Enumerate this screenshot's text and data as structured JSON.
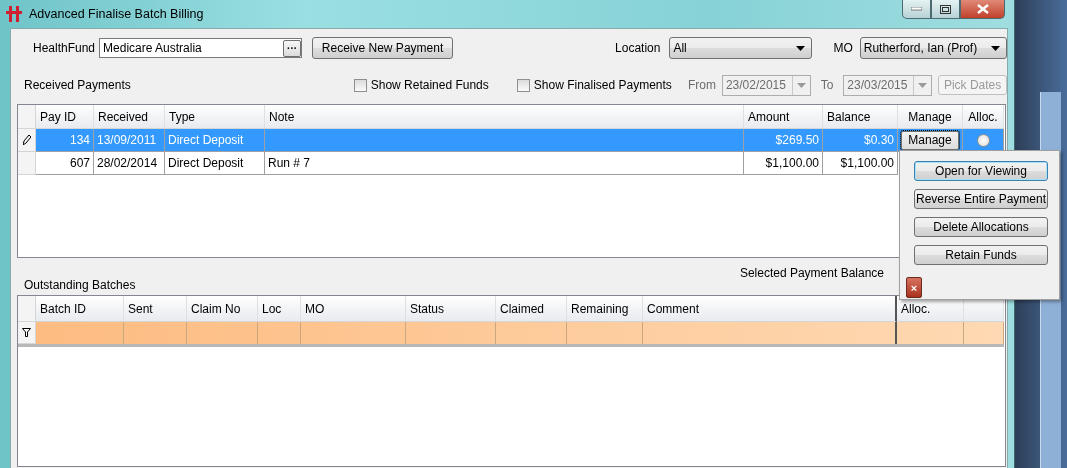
{
  "window": {
    "title": "Advanced Finalise Batch Billing"
  },
  "filters": {
    "health_fund": {
      "label": "HealthFund",
      "value": "Medicare Australia",
      "browse": "···"
    },
    "receive_button": "Receive New Payment",
    "location": {
      "label": "Location",
      "value": "All"
    },
    "mo": {
      "label": "MO",
      "value": "Rutherford, Ian (Prof)"
    }
  },
  "received_payments": {
    "title": "Received Payments",
    "options": [
      {
        "label": "Show Retained Funds",
        "checked": false
      },
      {
        "label": "Show Finalised Payments",
        "checked": false
      }
    ],
    "from": {
      "label": "From",
      "value": "23/02/2015",
      "disabled": true
    },
    "to": {
      "label": "To",
      "value": "23/03/2015",
      "disabled": true
    },
    "pick_dates": {
      "label": "Pick Dates",
      "disabled": true
    },
    "columns": [
      "Pay ID",
      "Received",
      "Type",
      "Note",
      "Amount",
      "Balance",
      "Manage",
      "Alloc."
    ],
    "rows": [
      {
        "selected": true,
        "editing": true,
        "pay_id": "134",
        "received": "13/09/2011",
        "type": "Direct Deposit",
        "note": "",
        "amount": "$269.50",
        "balance": "$0.30",
        "manage": "Manage",
        "alloc": {
          "checked": false
        }
      },
      {
        "selected": false,
        "editing": false,
        "pay_id": "607",
        "received": "28/02/2014",
        "type": "Direct Deposit",
        "note": "Run # 7",
        "amount": "$1,100.00",
        "balance": "$1,100.00"
      }
    ]
  },
  "selected_payment_balance": {
    "label": "Selected Payment Balance"
  },
  "outstanding_batches": {
    "title": "Outstanding Batches",
    "columns": [
      "Batch ID",
      "Sent",
      "Claim No",
      "Loc",
      "MO",
      "Status",
      "Claimed",
      "Remaining",
      "Comment",
      "Alloc.",
      ""
    ]
  },
  "manage_menu": {
    "items": [
      {
        "label": "Open for Viewing",
        "focused": true
      },
      {
        "label": "Reverse Entire Payment",
        "focused": false
      },
      {
        "label": "Delete Allocations",
        "focused": false
      },
      {
        "label": "Retain Funds",
        "focused": false
      }
    ],
    "close": "×"
  }
}
